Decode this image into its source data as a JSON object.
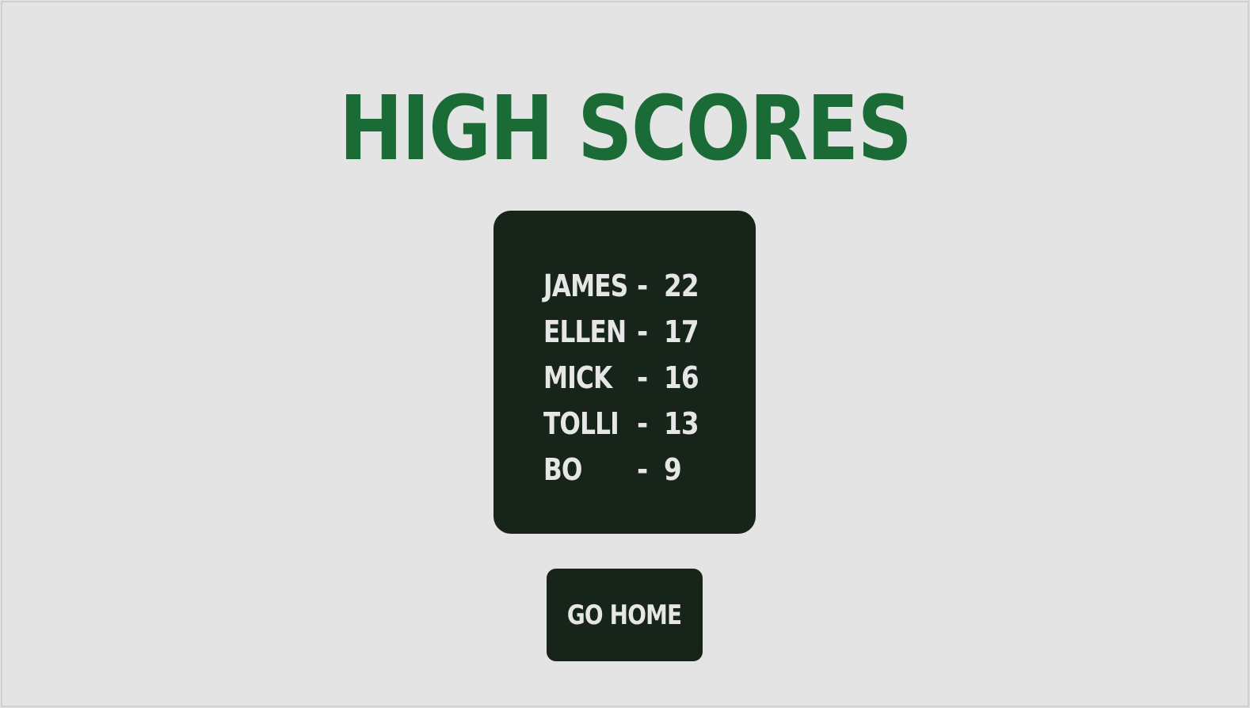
{
  "title": "HIGH SCORES",
  "scores": [
    {
      "name": "JAMES",
      "dash": "-",
      "score": "22"
    },
    {
      "name": "ELLEN",
      "dash": "-",
      "score": "17"
    },
    {
      "name": "MICK",
      "dash": "-",
      "score": "16"
    },
    {
      "name": "TOLLI",
      "dash": "-",
      "score": "13"
    },
    {
      "name": "BO",
      "dash": "-",
      "score": "9"
    }
  ],
  "buttons": {
    "home_label": "GO HOME"
  },
  "colors": {
    "background": "#e4e4e4",
    "title": "#1a6b36",
    "panel": "#17241a",
    "text_light": "#e6e6e6"
  }
}
